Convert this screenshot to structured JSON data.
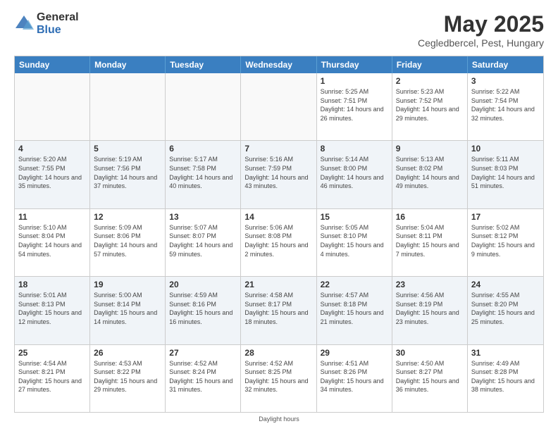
{
  "logo": {
    "general": "General",
    "blue": "Blue"
  },
  "header": {
    "title": "May 2025",
    "subtitle": "Cegledbercel, Pest, Hungary"
  },
  "days_of_week": [
    "Sunday",
    "Monday",
    "Tuesday",
    "Wednesday",
    "Thursday",
    "Friday",
    "Saturday"
  ],
  "footer": {
    "daylight_label": "Daylight hours"
  },
  "weeks": [
    [
      {
        "day": "",
        "sunrise": "",
        "sunset": "",
        "daylight": "",
        "empty": true
      },
      {
        "day": "",
        "sunrise": "",
        "sunset": "",
        "daylight": "",
        "empty": true
      },
      {
        "day": "",
        "sunrise": "",
        "sunset": "",
        "daylight": "",
        "empty": true
      },
      {
        "day": "",
        "sunrise": "",
        "sunset": "",
        "daylight": "",
        "empty": true
      },
      {
        "day": "1",
        "sunrise": "Sunrise: 5:25 AM",
        "sunset": "Sunset: 7:51 PM",
        "daylight": "Daylight: 14 hours and 26 minutes."
      },
      {
        "day": "2",
        "sunrise": "Sunrise: 5:23 AM",
        "sunset": "Sunset: 7:52 PM",
        "daylight": "Daylight: 14 hours and 29 minutes."
      },
      {
        "day": "3",
        "sunrise": "Sunrise: 5:22 AM",
        "sunset": "Sunset: 7:54 PM",
        "daylight": "Daylight: 14 hours and 32 minutes."
      }
    ],
    [
      {
        "day": "4",
        "sunrise": "Sunrise: 5:20 AM",
        "sunset": "Sunset: 7:55 PM",
        "daylight": "Daylight: 14 hours and 35 minutes."
      },
      {
        "day": "5",
        "sunrise": "Sunrise: 5:19 AM",
        "sunset": "Sunset: 7:56 PM",
        "daylight": "Daylight: 14 hours and 37 minutes."
      },
      {
        "day": "6",
        "sunrise": "Sunrise: 5:17 AM",
        "sunset": "Sunset: 7:58 PM",
        "daylight": "Daylight: 14 hours and 40 minutes."
      },
      {
        "day": "7",
        "sunrise": "Sunrise: 5:16 AM",
        "sunset": "Sunset: 7:59 PM",
        "daylight": "Daylight: 14 hours and 43 minutes."
      },
      {
        "day": "8",
        "sunrise": "Sunrise: 5:14 AM",
        "sunset": "Sunset: 8:00 PM",
        "daylight": "Daylight: 14 hours and 46 minutes."
      },
      {
        "day": "9",
        "sunrise": "Sunrise: 5:13 AM",
        "sunset": "Sunset: 8:02 PM",
        "daylight": "Daylight: 14 hours and 49 minutes."
      },
      {
        "day": "10",
        "sunrise": "Sunrise: 5:11 AM",
        "sunset": "Sunset: 8:03 PM",
        "daylight": "Daylight: 14 hours and 51 minutes."
      }
    ],
    [
      {
        "day": "11",
        "sunrise": "Sunrise: 5:10 AM",
        "sunset": "Sunset: 8:04 PM",
        "daylight": "Daylight: 14 hours and 54 minutes."
      },
      {
        "day": "12",
        "sunrise": "Sunrise: 5:09 AM",
        "sunset": "Sunset: 8:06 PM",
        "daylight": "Daylight: 14 hours and 57 minutes."
      },
      {
        "day": "13",
        "sunrise": "Sunrise: 5:07 AM",
        "sunset": "Sunset: 8:07 PM",
        "daylight": "Daylight: 14 hours and 59 minutes."
      },
      {
        "day": "14",
        "sunrise": "Sunrise: 5:06 AM",
        "sunset": "Sunset: 8:08 PM",
        "daylight": "Daylight: 15 hours and 2 minutes."
      },
      {
        "day": "15",
        "sunrise": "Sunrise: 5:05 AM",
        "sunset": "Sunset: 8:10 PM",
        "daylight": "Daylight: 15 hours and 4 minutes."
      },
      {
        "day": "16",
        "sunrise": "Sunrise: 5:04 AM",
        "sunset": "Sunset: 8:11 PM",
        "daylight": "Daylight: 15 hours and 7 minutes."
      },
      {
        "day": "17",
        "sunrise": "Sunrise: 5:02 AM",
        "sunset": "Sunset: 8:12 PM",
        "daylight": "Daylight: 15 hours and 9 minutes."
      }
    ],
    [
      {
        "day": "18",
        "sunrise": "Sunrise: 5:01 AM",
        "sunset": "Sunset: 8:13 PM",
        "daylight": "Daylight: 15 hours and 12 minutes."
      },
      {
        "day": "19",
        "sunrise": "Sunrise: 5:00 AM",
        "sunset": "Sunset: 8:14 PM",
        "daylight": "Daylight: 15 hours and 14 minutes."
      },
      {
        "day": "20",
        "sunrise": "Sunrise: 4:59 AM",
        "sunset": "Sunset: 8:16 PM",
        "daylight": "Daylight: 15 hours and 16 minutes."
      },
      {
        "day": "21",
        "sunrise": "Sunrise: 4:58 AM",
        "sunset": "Sunset: 8:17 PM",
        "daylight": "Daylight: 15 hours and 18 minutes."
      },
      {
        "day": "22",
        "sunrise": "Sunrise: 4:57 AM",
        "sunset": "Sunset: 8:18 PM",
        "daylight": "Daylight: 15 hours and 21 minutes."
      },
      {
        "day": "23",
        "sunrise": "Sunrise: 4:56 AM",
        "sunset": "Sunset: 8:19 PM",
        "daylight": "Daylight: 15 hours and 23 minutes."
      },
      {
        "day": "24",
        "sunrise": "Sunrise: 4:55 AM",
        "sunset": "Sunset: 8:20 PM",
        "daylight": "Daylight: 15 hours and 25 minutes."
      }
    ],
    [
      {
        "day": "25",
        "sunrise": "Sunrise: 4:54 AM",
        "sunset": "Sunset: 8:21 PM",
        "daylight": "Daylight: 15 hours and 27 minutes."
      },
      {
        "day": "26",
        "sunrise": "Sunrise: 4:53 AM",
        "sunset": "Sunset: 8:22 PM",
        "daylight": "Daylight: 15 hours and 29 minutes."
      },
      {
        "day": "27",
        "sunrise": "Sunrise: 4:52 AM",
        "sunset": "Sunset: 8:24 PM",
        "daylight": "Daylight: 15 hours and 31 minutes."
      },
      {
        "day": "28",
        "sunrise": "Sunrise: 4:52 AM",
        "sunset": "Sunset: 8:25 PM",
        "daylight": "Daylight: 15 hours and 32 minutes."
      },
      {
        "day": "29",
        "sunrise": "Sunrise: 4:51 AM",
        "sunset": "Sunset: 8:26 PM",
        "daylight": "Daylight: 15 hours and 34 minutes."
      },
      {
        "day": "30",
        "sunrise": "Sunrise: 4:50 AM",
        "sunset": "Sunset: 8:27 PM",
        "daylight": "Daylight: 15 hours and 36 minutes."
      },
      {
        "day": "31",
        "sunrise": "Sunrise: 4:49 AM",
        "sunset": "Sunset: 8:28 PM",
        "daylight": "Daylight: 15 hours and 38 minutes."
      }
    ]
  ]
}
